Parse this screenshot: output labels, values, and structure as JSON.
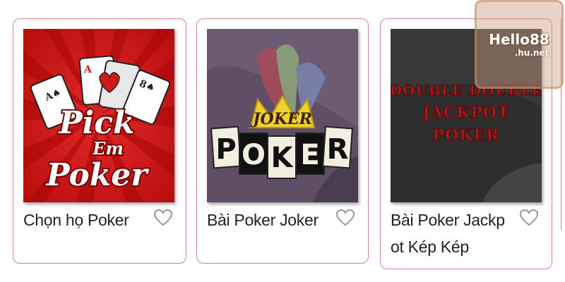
{
  "games": [
    {
      "title": "Chọn họ Poker",
      "logo_lines": [
        "Pick",
        "Em",
        "Poker"
      ],
      "colors": {
        "bg": "#d01818",
        "ray": "#a00808",
        "text": "#ffffff",
        "outline": "#7a0000"
      }
    },
    {
      "title": "Bài Poker Joker",
      "logo_word": "JOKER",
      "logo_letters": [
        "P",
        "O",
        "K",
        "E",
        "R"
      ],
      "colors": {
        "bg": "#5f4e66",
        "crown": "#f0d030",
        "tile_light": "#f2eee0",
        "tile_dark": "#111111"
      }
    },
    {
      "title": "Bài Poker Jackpot Kép Kép",
      "title_lines": [
        "Bài Poker Jackp",
        "ot Kép Kép"
      ],
      "logo_lines": [
        "DOUBLE DOUBLE",
        "JACKPOT",
        "POKER"
      ],
      "colors": {
        "bg": "#2e2e2e",
        "text": "#b01818"
      }
    }
  ],
  "watermark": {
    "line1": "Hello88",
    "line2": ".hu.net"
  },
  "icons": {
    "favorite": "heart-outline-icon"
  },
  "colors": {
    "card_border": "#c98b8b",
    "heart": "#999999"
  }
}
